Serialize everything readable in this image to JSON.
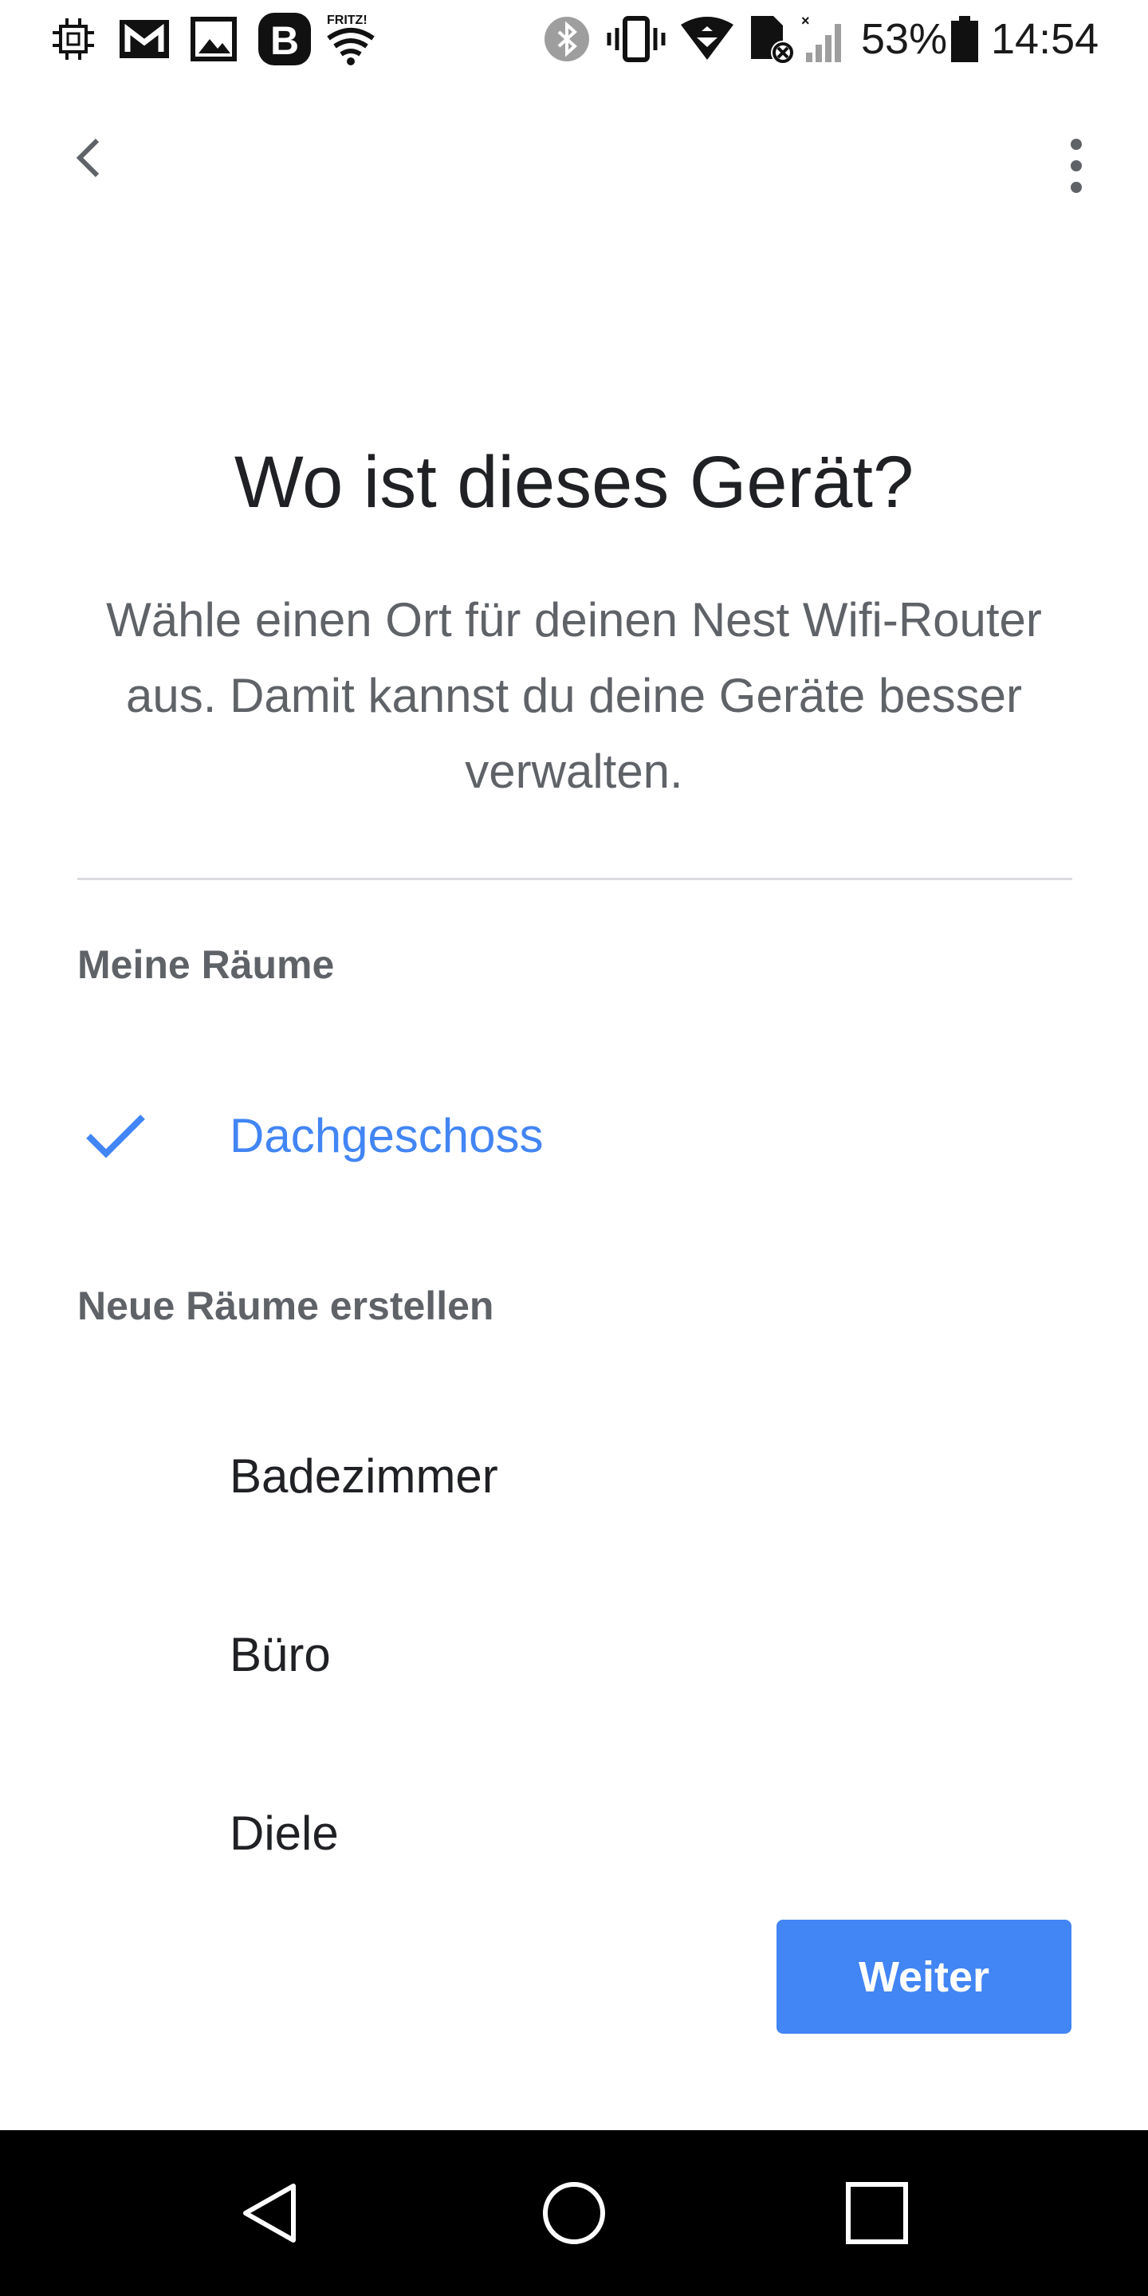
{
  "status_bar": {
    "battery_percent": "53%",
    "time": "14:54",
    "icons": [
      "cpu-icon",
      "gmail-icon",
      "gallery-icon",
      "b-app-icon",
      "fritz-wifi-icon",
      "bluetooth-icon",
      "vibrate-icon",
      "wifi-icon",
      "no-sim-icon",
      "signal-icon",
      "battery-icon"
    ],
    "fritz_label": "FRITZ!"
  },
  "app_bar": {
    "back_icon": "chevron-left-icon",
    "menu_icon": "more-vert-icon"
  },
  "header": {
    "title": "Wo ist dieses Gerät?",
    "subtitle": "Wähle einen Ort für deinen Nest Wifi-Router aus. Damit kannst du deine Geräte besser verwalten."
  },
  "my_rooms": {
    "label": "Meine Räume",
    "items": [
      {
        "label": "Dachgeschoss",
        "selected": true
      }
    ]
  },
  "new_rooms": {
    "label": "Neue Räume erstellen",
    "items": [
      {
        "label": "Badezimmer"
      },
      {
        "label": "Büro"
      },
      {
        "label": "Diele"
      }
    ]
  },
  "actions": {
    "next_label": "Weiter"
  },
  "colors": {
    "accent": "#4285f4",
    "title": "#202124",
    "secondary_text": "#5f6368",
    "divider": "#dadce0"
  },
  "nav_bar": {
    "icons": [
      "back-triangle-icon",
      "home-circle-icon",
      "recents-square-icon"
    ]
  }
}
